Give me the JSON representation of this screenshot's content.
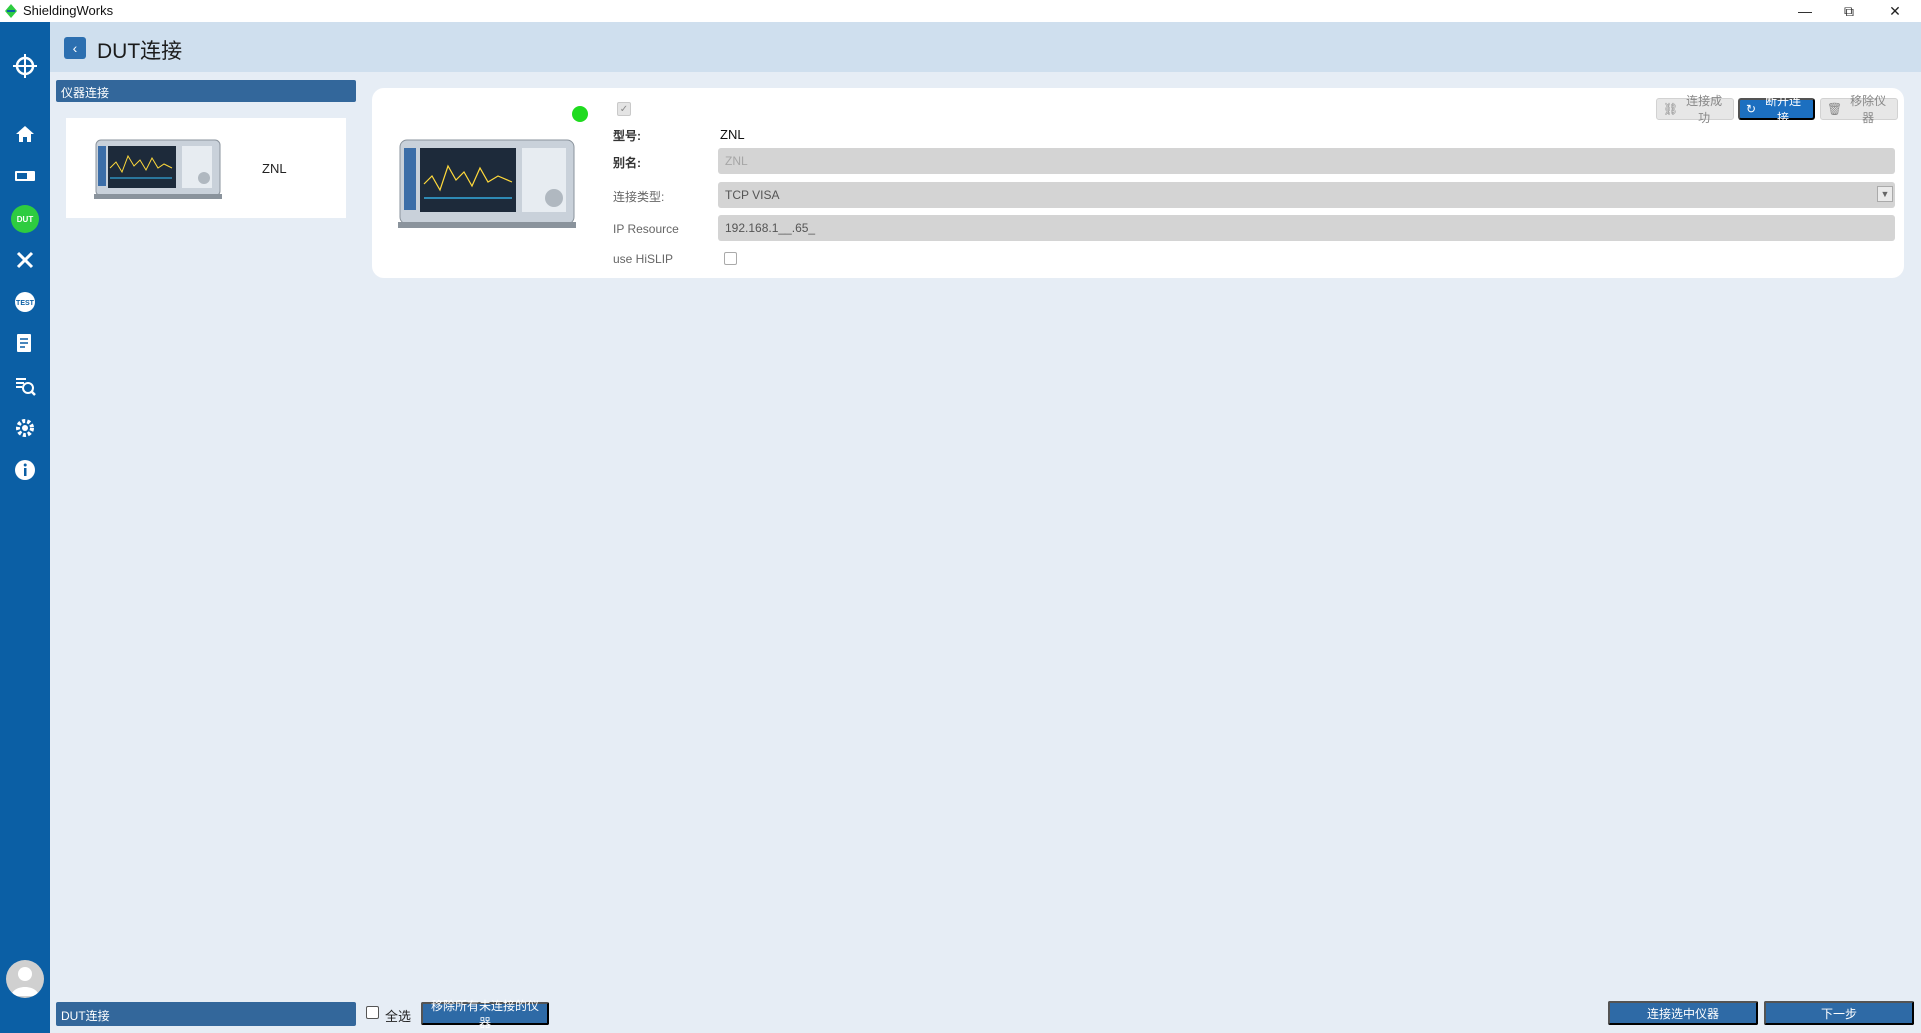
{
  "window": {
    "title": "ShieldingWorks",
    "minimize": "—",
    "maximize": "⧉",
    "close": "✕"
  },
  "header": {
    "back": "‹",
    "title": "DUT连接"
  },
  "sidebar": {
    "dut_badge": "DUT"
  },
  "instrument_list": {
    "header": "仪器连接",
    "items": [
      {
        "name": "ZNL"
      }
    ]
  },
  "detail": {
    "toolbar": {
      "connected": "连接成功",
      "disconnect": "断开连接",
      "remove": "移除仪器"
    },
    "model_label": "型号:",
    "model_value": "ZNL",
    "alias_label": "别名:",
    "alias_value": "ZNL",
    "conn_type_label": "连接类型:",
    "conn_type_value": "TCP VISA",
    "ip_label": "IP Resource",
    "ip_value": "192.168.1__.65_",
    "hislip_label": "use HiSLIP"
  },
  "bottom": {
    "status": "DUT连接",
    "select_all": "全选",
    "remove_all": "移除所有未连接的仪器",
    "connect_selected": "连接选中仪器",
    "next": "下一步"
  },
  "colors": {
    "sidebar": "#0b5fa5",
    "accent": "#1c6fc0",
    "status_ok": "#1fdb1f"
  }
}
